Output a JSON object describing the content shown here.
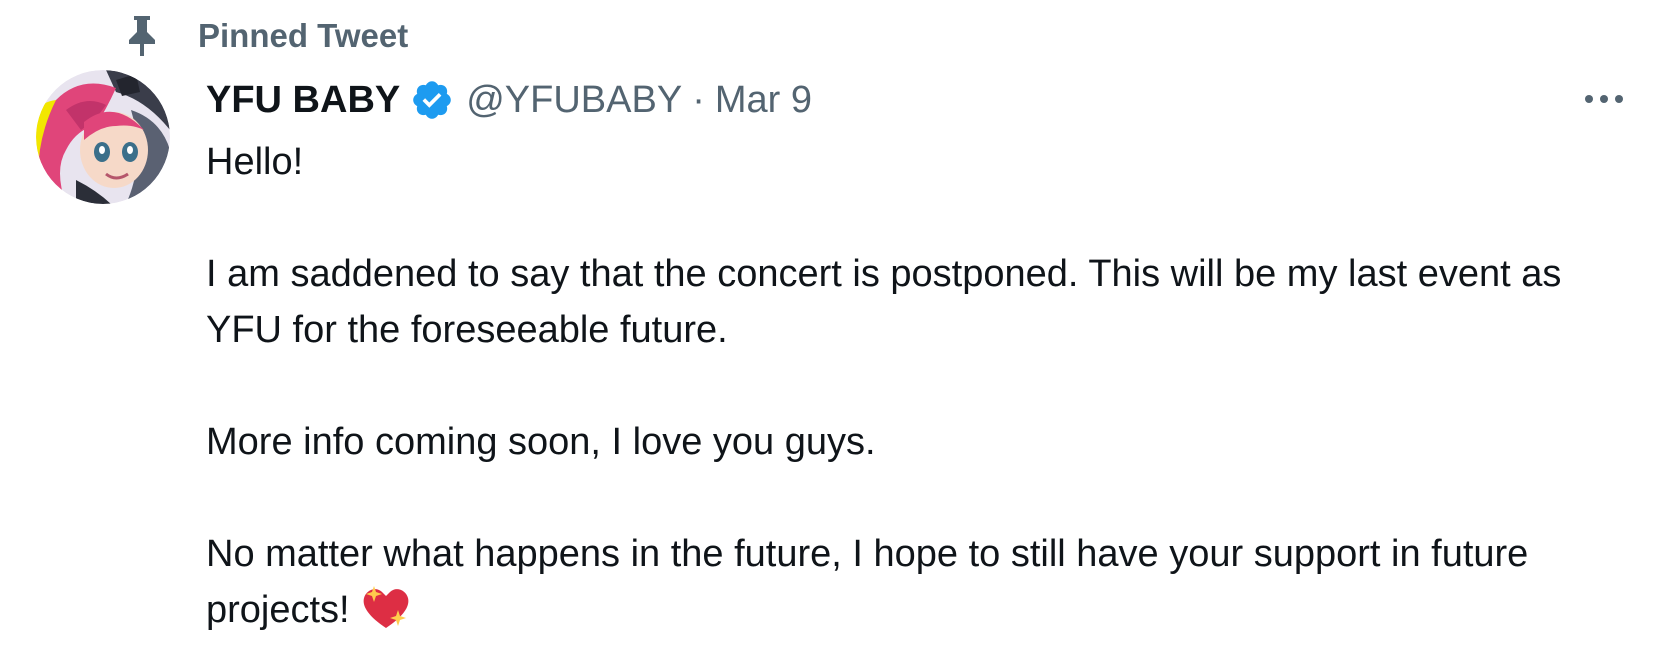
{
  "pinned": {
    "label": "Pinned Tweet",
    "icon": "pin-icon"
  },
  "author": {
    "display_name": "YFU BABY",
    "verified_icon": "verified-badge-icon",
    "handle": "@YFUBABY",
    "separator": "·",
    "date": "Mar 9"
  },
  "tweet": {
    "paragraphs": [
      "Hello!",
      "I am saddened to say that the concert is postponed. This will be my last event as YFU for the foreseeable future.",
      "More info coming soon, I love you guys.",
      "No matter what happens in the future, I hope to still have your support in future projects!"
    ],
    "trailing_emoji": "sparkling-heart-icon"
  },
  "colors": {
    "text_primary": "#0f1419",
    "text_secondary": "#536471",
    "verified_blue": "#1d9bf0",
    "heart_red": "#dd2e44",
    "sparkle_yellow": "#ffcc4d"
  }
}
